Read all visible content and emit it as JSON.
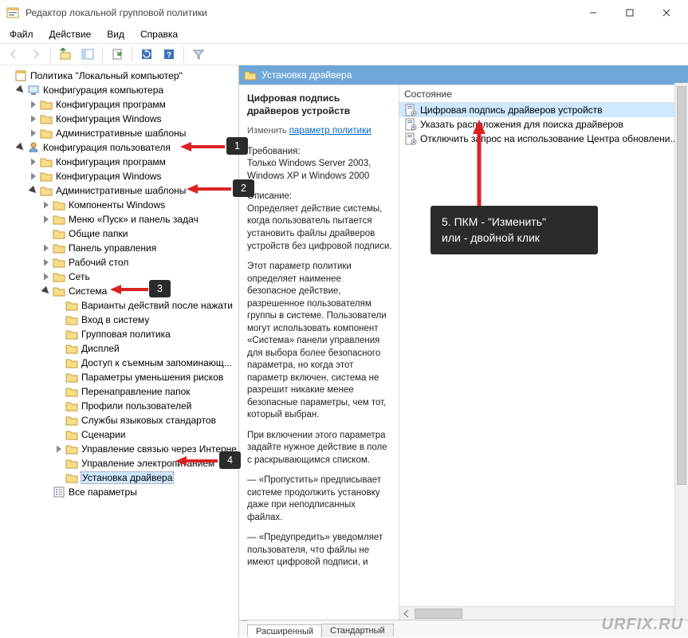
{
  "window": {
    "title": "Редактор локальной групповой политики"
  },
  "menu": {
    "file": "Файл",
    "action": "Действие",
    "view": "Вид",
    "help": "Справка"
  },
  "tree": {
    "root": "Политика \"Локальный компьютер\"",
    "computer_config": "Конфигурация компьютера",
    "cc_programs": "Конфигурация программ",
    "cc_windows": "Конфигурация Windows",
    "cc_admin": "Административные шаблоны",
    "user_config": "Конфигурация пользователя",
    "uc_programs": "Конфигурация программ",
    "uc_windows": "Конфигурация Windows",
    "uc_admin": "Административные шаблоны",
    "comp_win": "Компоненты Windows",
    "startmenu": "Меню «Пуск» и панель задач",
    "shared": "Общие папки",
    "cpanel": "Панель управления",
    "desktop": "Рабочий стол",
    "network": "Сеть",
    "system": "Система",
    "s_variants": "Варианты действий после нажати",
    "s_logon": "Вход в систему",
    "s_gp": "Групповая политика",
    "s_display": "Дисплей",
    "s_removable": "Доступ к съемным запоминающ...",
    "s_riskmit": "Параметры уменьшения рисков",
    "s_folderredir": "Перенаправление папок",
    "s_profiles": "Профили пользователей",
    "s_lang": "Службы языковых стандартов",
    "s_scripts": "Сценарии",
    "s_inetcomm": "Управление связью через Интерне",
    "s_power": "Управление электропитанием",
    "s_driverinstall": "Установка драйвера",
    "allsettings": "Все параметры"
  },
  "details": {
    "header": "Установка драйвера",
    "title": "Цифровая подпись драйверов устройств",
    "edit_prefix": "Изменить ",
    "edit_link": "параметр политики",
    "req_label": "Требования:",
    "req_body": "Только Windows Server 2003, Windows XP и Windows 2000",
    "desc_label": "Описание:",
    "desc_p1": "Определяет действие системы, когда пользователь пытается установить файлы драйверов устройств без цифровой подписи.",
    "desc_p2": "Этот параметр политики определяет наименее безопасное действие, разрешенное пользователям группы в системе. Пользователи могут использовать компонент «Система» панели управления для выбора более безопасного параметра, но когда этот параметр включен, система не разрешит никакие менее безопасные параметры, чем тот, который выбран.",
    "desc_p3": "При включении этого параметра задайте нужное действие в поле с раскрывающимся списком.",
    "desc_p4": "— «Пропустить» предписывает системе продолжить установку даже при неподписанных файлах.",
    "desc_p5": "— «Предупредить» уведомляет пользователя, что файлы не имеют цифровой подписи, и",
    "column": "Состояние",
    "item1": "Цифровая подпись драйверов устройств",
    "item2": "Указать расположения для поиска драйверов",
    "item3": "Отключить запрос на использование Центра обновлени...",
    "tab_ext": "Расширенный",
    "tab_std": "Стандартный"
  },
  "annot": {
    "n1": "1",
    "n2": "2",
    "n3": "3",
    "n4": "4",
    "n5_l1": "5. ПКМ - \"Изменить\"",
    "n5_l2": "или - двойной клик"
  },
  "watermark": "URFIX.RU"
}
